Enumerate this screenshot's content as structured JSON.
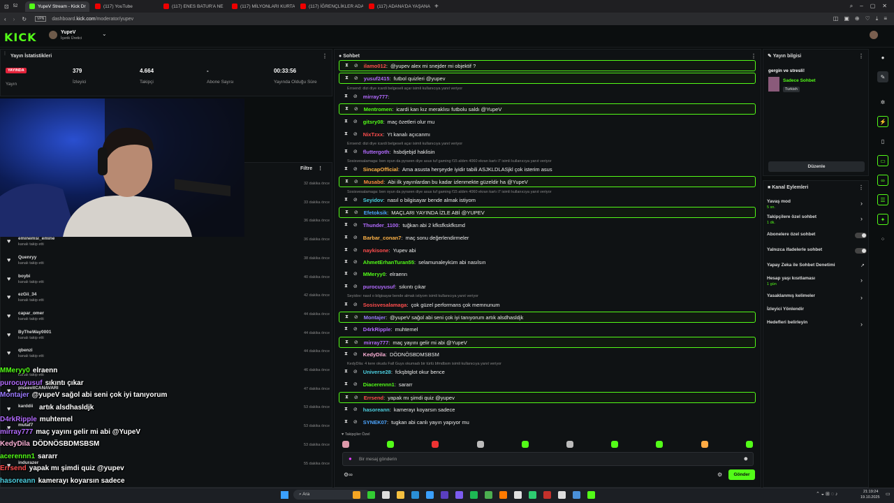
{
  "browser": {
    "tabs": [
      {
        "label": "YupeV Stream - Kick Dr",
        "active": true,
        "kind": "kick"
      },
      {
        "label": "(117) YouTube",
        "active": false,
        "kind": "yt"
      },
      {
        "label": "(117) ENES BATUR'A NE",
        "active": false,
        "kind": "yt"
      },
      {
        "label": "(117) MİLYONLARI KURTA",
        "active": false,
        "kind": "yt"
      },
      {
        "label": "(117) İĞRENÇLİKLER ADA",
        "active": false,
        "kind": "yt"
      },
      {
        "label": "(117) ADANA'DA YAŞANA",
        "active": false,
        "kind": "yt"
      }
    ],
    "tab_count": "52",
    "url_prefix": "dashboard.",
    "url_domain": "kick.com",
    "url_path": "/moderator/yupev"
  },
  "header": {
    "logo": "KICK",
    "user_name": "YupeV",
    "user_role": "İçerik Üretici"
  },
  "stats": {
    "title": "Yayın İstatistikleri",
    "live_badge": "YAYINDA",
    "live_label": "Yayın",
    "viewers": "379",
    "viewers_label": "İzleyici",
    "followers": "4.664",
    "followers_label": "Takipçi",
    "subs": "-",
    "subs_label": "Abone Sayısı",
    "duration": "00:33:56",
    "duration_label": "Yayında Olduğu Süre"
  },
  "activity": {
    "filter_label": "Filtre",
    "rows": [
      {
        "name": "",
        "sub": "",
        "time": "32 dakika önce"
      },
      {
        "name": "",
        "sub": "",
        "time": "33 dakika önce"
      },
      {
        "name": "",
        "sub": "",
        "time": "36 dakika önce"
      },
      {
        "name": "eminemsi_emine",
        "sub": "kanalı takip etti",
        "time": "36 dakika önce"
      },
      {
        "name": "Quenryy",
        "sub": "kanalı takip etti",
        "time": "38 dakika önce"
      },
      {
        "name": "boybi",
        "sub": "kanalı takip etti",
        "time": "40 dakika önce"
      },
      {
        "name": "ezGii_34",
        "sub": "kanalı takip etti",
        "time": "42 dakika önce"
      },
      {
        "name": "capar_omer",
        "sub": "kanalı takip etti",
        "time": "44 dakika önce"
      },
      {
        "name": "ByTheWay0001",
        "sub": "kanalı takip etti",
        "time": "44 dakika önce"
      },
      {
        "name": "qbenzi",
        "sub": "kanalı takip etti",
        "time": "44 dakika önce"
      },
      {
        "name": "",
        "sub": "kanalı takip etti",
        "time": "46 dakika önce"
      },
      {
        "name": "piskevitCANAVARI",
        "sub": "",
        "time": "47 dakika önce"
      },
      {
        "name": "karddii",
        "sub": "",
        "time": "53 dakika önce"
      },
      {
        "name": "mutaf7",
        "sub": "",
        "time": "53 dakika önce"
      },
      {
        "name": "",
        "sub": "",
        "time": "53 dakika önce"
      },
      {
        "name": "indurazer",
        "sub": "",
        "time": "55 dakika önce"
      }
    ]
  },
  "overlay_chat": [
    {
      "user": "MMeryy0",
      "msg": "elraenn",
      "color": "#53fc18"
    },
    {
      "user": "purocuyusuf",
      "msg": "sıkıntı çıkar",
      "color": "#b36bff"
    },
    {
      "user": "Montajer",
      "msg": "@yupeV sağol abi seni çok iyi tanıyorum",
      "color": "#9b7bff"
    },
    {
      "user": "",
      "msg": "artık alsdhasldjk",
      "color": "#ffffff"
    },
    {
      "user": "D4rkRipple",
      "msg": "muhtemel",
      "color": "#b36bff"
    },
    {
      "user": "mirray777",
      "msg": "maç yayını gelir mi abi @YupeV",
      "color": "#b36bff"
    },
    {
      "user": "KedyDila",
      "msg": "DÖDNÖSBDMSBSM",
      "color": "#ffb3d9"
    },
    {
      "user": "acerennn1",
      "msg": "sararr",
      "color": "#53fc18"
    },
    {
      "user": "Errsend",
      "msg": "yapak mı şimdi quiz @yupev",
      "color": "#ff4d4d"
    },
    {
      "user": "hasoreann",
      "msg": "kamerayı koyarsın sadece",
      "color": "#4dd0e1"
    },
    {
      "user": "SYNEK07",
      "msg": "tugkan abi canlı yayın yapıyor mu",
      "color": "#4da6ff"
    }
  ],
  "chat": {
    "title": "Sohbet",
    "messages": [
      {
        "user": "ilamo012",
        "msg": "@yupev alex mi snejder mi objektif ?",
        "color": "#ff4d4d",
        "hl": true,
        "reply": ""
      },
      {
        "user": "yusuf2415",
        "msg": "futbol quizleri @yupev",
        "color": "#b36bff",
        "hl": true,
        "reply": ""
      },
      {
        "user": "mirray777",
        "msg": "",
        "color": "#b36bff",
        "hl": false,
        "reply": "Errsend: dizi diye icardi belgeseli açar isimli kullanıcıya yanıt veriyor"
      },
      {
        "user": "Mentromen",
        "msg": "icardi karı kız meraklısı futbolu saldı @YupeV",
        "color": "#53fc18",
        "hl": true,
        "reply": ""
      },
      {
        "user": "gitsry08",
        "msg": "maç özetleri olur mu",
        "color": "#53fc18",
        "hl": false,
        "reply": ""
      },
      {
        "user": "NixTzxx",
        "msg": "Yt kanalı açıcanmı",
        "color": "#ff4d4d",
        "hl": false,
        "reply": ""
      },
      {
        "user": "fluttergoth",
        "msg": "hsbdjebjd haklisin",
        "color": "#b36bff",
        "hl": false,
        "reply": "Errsend: dizi diye icardi belgeseli açar isimli kullanıcıya yanıt veriyor"
      },
      {
        "user": "SincapOfficial",
        "msg": "Ama asusta herşeyde iyidir tabili ASJKLDLASjkl çok isterim asus",
        "color": "#ffb347",
        "hl": false,
        "reply": "Sosisvesalamaga: ben oyun da pyraren diye asus tuf gaming f15 aldım 4060 ekran kartı i7 isimli kullanıcıya yanıt veriyor"
      },
      {
        "user": "Musabd",
        "msg": "Abi ilk yayınlardan bu kadar izlenmekte güzeldir ha @YupeV",
        "color": "#ff8c42",
        "hl": true,
        "reply": ""
      },
      {
        "user": "Seyidov",
        "msg": "nasıl o bilgisayar bende almak istiyom",
        "color": "#4dd0e1",
        "hl": false,
        "reply": "Sosisvesalamaga: ben oyun da pyraren diye asus tuf gaming f15 aldım 4060 ekran kartı i7 isimli kullanıcıya yanıt veriyor"
      },
      {
        "user": "Efetoksik",
        "msg": "MAÇLARI YAYINDA İZLE ABİ @YUPEV",
        "color": "#4da6ff",
        "hl": true,
        "reply": ""
      },
      {
        "user": "Thunder_1100",
        "msg": "tuğkan abi 2 kfksfkskfksmd",
        "color": "#b36bff",
        "hl": false,
        "reply": ""
      },
      {
        "user": "Barbar_conan7",
        "msg": "maç sonu değerlendirmeler",
        "color": "#ffb347",
        "hl": false,
        "reply": ""
      },
      {
        "user": "naykisone",
        "msg": "Yupev abi",
        "color": "#ff4d4d",
        "hl": false,
        "reply": ""
      },
      {
        "user": "AhmetErhanTuran55",
        "msg": "selamunaleyküm abi nasılsın",
        "color": "#53fc18",
        "hl": false,
        "reply": ""
      },
      {
        "user": "MMeryy0",
        "msg": "elraenn",
        "color": "#53fc18",
        "hl": false,
        "reply": ""
      },
      {
        "user": "purocuyusuf",
        "msg": "sıkıntı çıkar",
        "color": "#b36bff",
        "hl": false,
        "reply": ""
      },
      {
        "user": "Sosisvesalamaga",
        "msg": "çok güzel performans çok memnunum",
        "color": "#ff4d4d",
        "hl": false,
        "reply": "Seyidov: nasıl o bilgisayar bende almak istiyom isimli kullanıcıya yanıt veriyor"
      },
      {
        "user": "Montajer",
        "msg": "@yupeV sağol abi seni çok iyi tanıyorum artık alsdhasldjk",
        "color": "#9b7bff",
        "hl": true,
        "reply": ""
      },
      {
        "user": "D4rkRipple",
        "msg": "muhtemel",
        "color": "#b36bff",
        "hl": false,
        "reply": ""
      },
      {
        "user": "mirray777",
        "msg": "maç yayını gelir mi abi @YupeV",
        "color": "#b36bff",
        "hl": true,
        "reply": ""
      },
      {
        "user": "KedyDila",
        "msg": "DÖDNÖSBDMSBSM",
        "color": "#ffb3d9",
        "hl": false,
        "reply": ""
      },
      {
        "user": "Universe28",
        "msg": "fckşbtglot okur bence",
        "color": "#4dd0e1",
        "hl": false,
        "reply": "KedyDila: 4 kere okudu Fall Guys okumadı bir türlü bfmdbsm isimli kullanıcıya yanıt veriyor"
      },
      {
        "user": "Diacerennn1",
        "msg": "sararr",
        "color": "#53fc18",
        "hl": false,
        "reply": ""
      },
      {
        "user": "Errsend",
        "msg": "yapak mı şimdi quiz @yupev",
        "color": "#ff4d4d",
        "hl": true,
        "reply": ""
      },
      {
        "user": "hasoreann",
        "msg": "kamerayı koyarsın sadece",
        "color": "#4dd0e1",
        "hl": false,
        "reply": ""
      },
      {
        "user": "SYNEK07",
        "msg": "tugkan abi canlı yayın yapıyor mu",
        "color": "#4da6ff",
        "hl": false,
        "reply": ""
      }
    ],
    "followers_only_label": "Takipçiler Özel",
    "input_placeholder": "Bir mesaj gönderin",
    "send_label": "Gönder"
  },
  "stream_info": {
    "title": "Yayın bilgisi",
    "stream_title": "gergin ve stresli!",
    "category": "Sadece Sohbet",
    "language": "Turkish",
    "edit_label": "Düzenle"
  },
  "channel_actions": {
    "title": "Kanal Eylemleri",
    "items": [
      {
        "label": "Yavaş mod",
        "sub": "5 sn.",
        "type": "chevron"
      },
      {
        "label": "Takipçilere özel sohbet",
        "sub": "1 dk.",
        "type": "chevron"
      },
      {
        "label": "Abonelere özel sohbet",
        "sub": "",
        "type": "toggle"
      },
      {
        "label": "Yalnızca ifadelerle sohbet",
        "sub": "",
        "type": "toggle"
      },
      {
        "label": "Yapay Zeka ile Sohbet Denetimi",
        "sub": "",
        "type": "external"
      },
      {
        "label": "Hesap yaşı kısıtlaması",
        "sub": "1 gün",
        "type": "chevron"
      },
      {
        "label": "Yasaklanmış kelimeler",
        "sub": "",
        "type": "chevron"
      },
      {
        "label": "İzleyici Yönlendir",
        "sub": "",
        "type": "none"
      },
      {
        "label": "Hedefleri belirleyin",
        "sub": "",
        "type": "chevron"
      }
    ]
  },
  "taskbar": {
    "search": "Ara",
    "time": "21:19:24",
    "date": "19.10.2025"
  }
}
